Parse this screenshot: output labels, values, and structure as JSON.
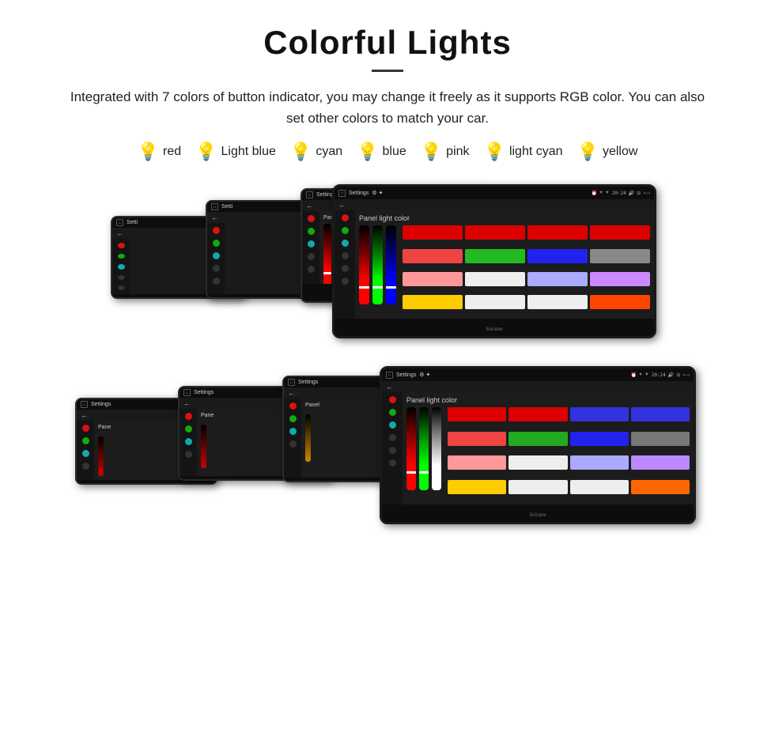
{
  "header": {
    "title": "Colorful Lights",
    "description": "Integrated with 7 colors of button indicator, you may change it freely as it supports RGB color. You can also set other colors to match your car."
  },
  "colors": [
    {
      "name": "red",
      "color": "#ff2255",
      "emoji": "🔴"
    },
    {
      "name": "Light blue",
      "color": "#88ccff",
      "emoji": "💙"
    },
    {
      "name": "cyan",
      "color": "#22dddd",
      "emoji": "🔵"
    },
    {
      "name": "blue",
      "color": "#4455ff",
      "emoji": "🔵"
    },
    {
      "name": "pink",
      "color": "#ff44bb",
      "emoji": "🩷"
    },
    {
      "name": "light cyan",
      "color": "#88eeff",
      "emoji": "💎"
    },
    {
      "name": "yellow",
      "color": "#ffee44",
      "emoji": "💛"
    }
  ],
  "device": {
    "settings_label": "Settings",
    "back_arrow": "←",
    "panel_light_color": "Panel light color",
    "watermark": "Seicane",
    "time": "20:24"
  },
  "swatches": {
    "row1": [
      "#ff0000",
      "#ff0000",
      "#0000ff",
      "#0000ff"
    ],
    "row2": [
      "#ff4444",
      "#22cc22",
      "#4444ff",
      "#888888"
    ],
    "row3": [
      "#ff8888",
      "#ffffff",
      "#aaaaff",
      "#cc88ff"
    ],
    "row4": [
      "#ffcc00",
      "#ffffff",
      "#ffffff",
      "#ff4400"
    ]
  }
}
